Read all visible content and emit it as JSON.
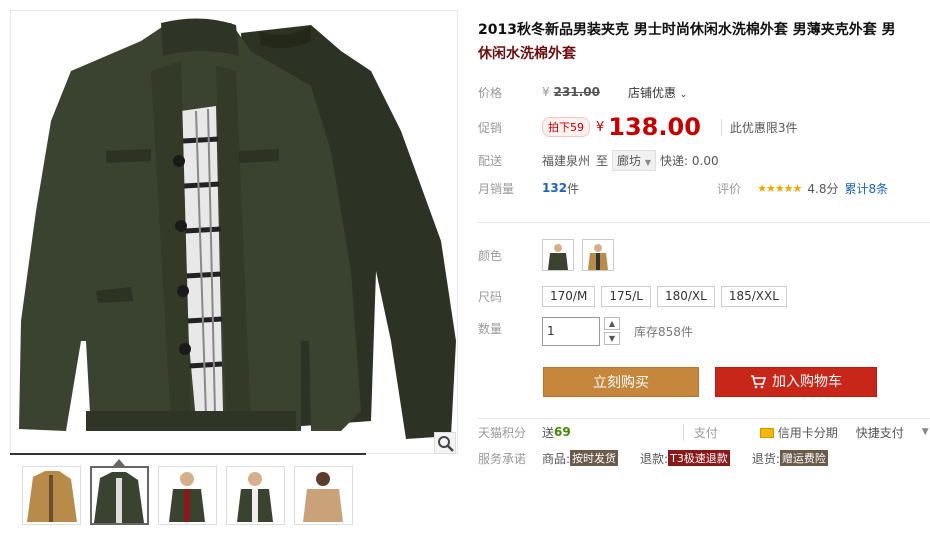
{
  "product": {
    "title_line1": "2013秋冬新品男装夹克 男士时尚休闲水洗棉外套 男薄夹克外套 男",
    "title_line2": "休闲水洗棉外套"
  },
  "price": {
    "label": "价格",
    "currency": "¥",
    "original": "231.00",
    "shop_promo": "店铺优惠"
  },
  "promo": {
    "label": "促销",
    "tag": "拍下59",
    "currency": "¥",
    "price": "138.00",
    "limit": "此优惠限3件"
  },
  "delivery": {
    "label": "配送",
    "from": "福建泉州",
    "to_word": "至",
    "city": "廊坊",
    "shipping": "快递: 0.00"
  },
  "sales": {
    "label": "月销量",
    "count": "132",
    "unit": "件",
    "rating_label": "评价",
    "stars": "★★★★★",
    "score": "4.8分",
    "total_reviews": "累计8条"
  },
  "options": {
    "color_label": "颜色",
    "size_label": "尺码",
    "sizes": [
      "170/M",
      "175/L",
      "180/XL",
      "185/XXL"
    ],
    "qty_label": "数量",
    "qty_value": "1",
    "stock": "库存858件"
  },
  "actions": {
    "buy": "立刻购买",
    "cart": "加入购物车"
  },
  "footer": {
    "points_label": "天猫积分",
    "points_prefix": "送",
    "points_value": "69",
    "pay_label": "支付",
    "credit": "信用卡分期",
    "quick_pay": "快捷支付",
    "service_label": "服务承诺",
    "goods": "商品:",
    "goods_badge": "按时发货",
    "refund": "退款:",
    "refund_badge": "T3极速退款",
    "return": "退货:",
    "return_badge": "赠运费险"
  },
  "colors": {
    "jacket_green": "#3a4230",
    "jacket_dark": "#2c3224",
    "khaki": "#b88b4a",
    "accent_red": "#c40000",
    "buy_orange": "#c6863c",
    "cart_red": "#c9261a"
  }
}
